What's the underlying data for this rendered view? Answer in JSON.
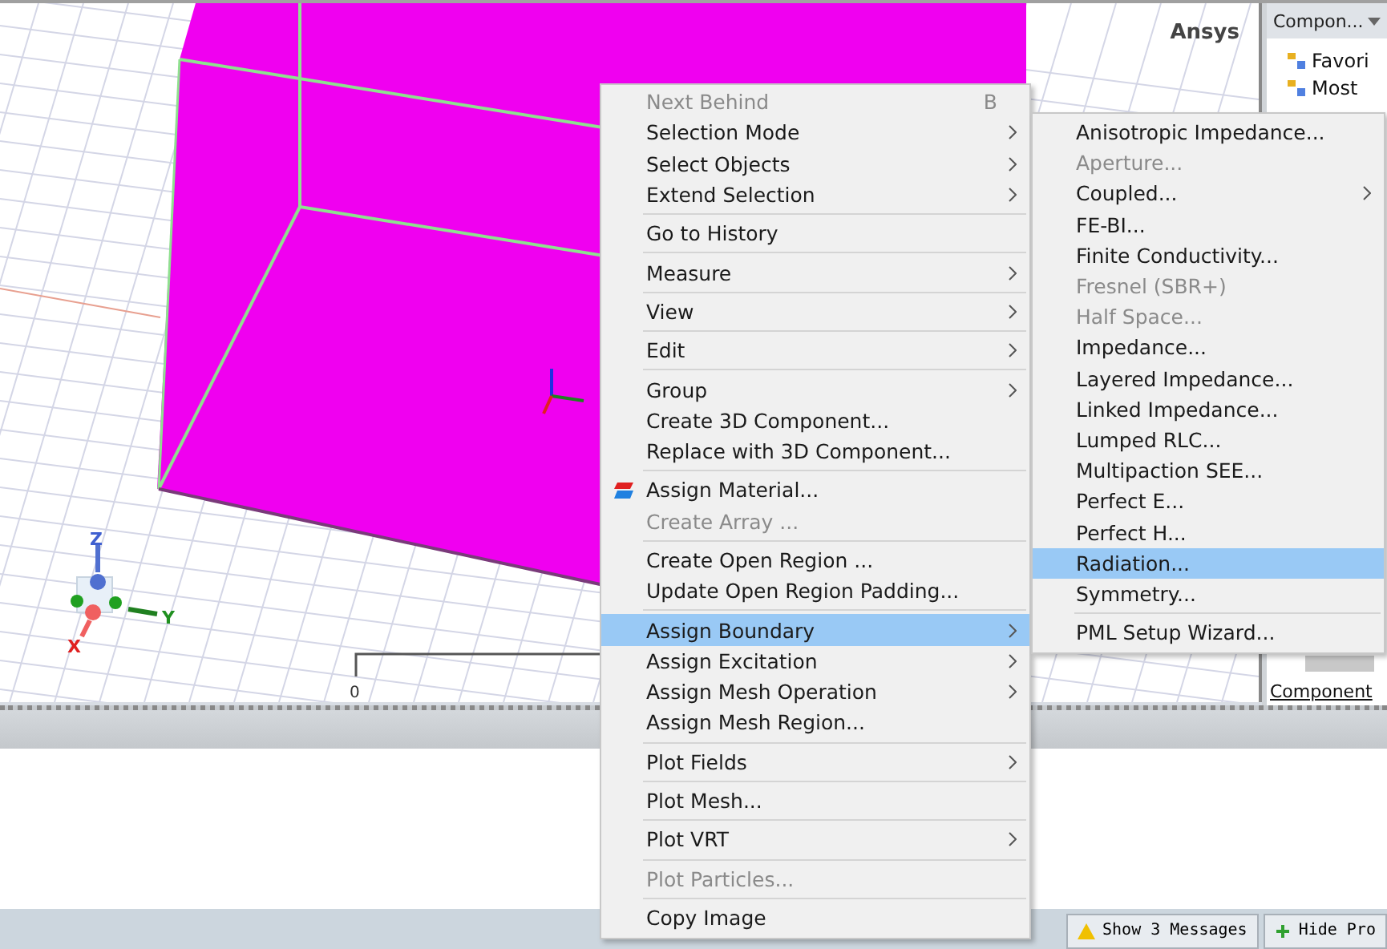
{
  "viewport": {
    "brand": "Ansys",
    "axes": {
      "z": "Z",
      "y": "Y",
      "x": "X"
    },
    "scale_label": "0"
  },
  "side_panel": {
    "title": "Compon...",
    "tree": [
      {
        "label": "Favori"
      },
      {
        "label": "Most"
      }
    ],
    "tab": "Component"
  },
  "context_menu": [
    {
      "kind": "item",
      "label": "Next Behind",
      "shortcut": "B",
      "submenu": false,
      "disabled": true,
      "selected": false,
      "icon": false
    },
    {
      "kind": "item",
      "label": "Selection Mode",
      "submenu": true,
      "disabled": false,
      "selected": false,
      "icon": false
    },
    {
      "kind": "item",
      "label": "Select Objects",
      "submenu": true,
      "disabled": false,
      "selected": false,
      "icon": false
    },
    {
      "kind": "item",
      "label": "Extend Selection",
      "submenu": true,
      "disabled": false,
      "selected": false,
      "icon": false
    },
    {
      "kind": "separator"
    },
    {
      "kind": "item",
      "label": "Go to History",
      "submenu": false,
      "disabled": false,
      "selected": false,
      "icon": false
    },
    {
      "kind": "separator"
    },
    {
      "kind": "item",
      "label": "Measure",
      "submenu": true,
      "disabled": false,
      "selected": false,
      "icon": false
    },
    {
      "kind": "separator"
    },
    {
      "kind": "item",
      "label": "View",
      "submenu": true,
      "disabled": false,
      "selected": false,
      "icon": false
    },
    {
      "kind": "separator"
    },
    {
      "kind": "item",
      "label": "Edit",
      "submenu": true,
      "disabled": false,
      "selected": false,
      "icon": false
    },
    {
      "kind": "separator"
    },
    {
      "kind": "item",
      "label": "Group",
      "submenu": true,
      "disabled": false,
      "selected": false,
      "icon": false
    },
    {
      "kind": "item",
      "label": "Create 3D Component...",
      "submenu": false,
      "disabled": false,
      "selected": false,
      "icon": false
    },
    {
      "kind": "item",
      "label": "Replace with 3D Component...",
      "submenu": false,
      "disabled": false,
      "selected": false,
      "icon": false
    },
    {
      "kind": "separator"
    },
    {
      "kind": "item",
      "label": "Assign Material...",
      "submenu": false,
      "disabled": false,
      "selected": false,
      "icon": true
    },
    {
      "kind": "item",
      "label": "Create Array ...",
      "submenu": false,
      "disabled": true,
      "selected": false,
      "icon": false
    },
    {
      "kind": "separator"
    },
    {
      "kind": "item",
      "label": "Create Open Region ...",
      "submenu": false,
      "disabled": false,
      "selected": false,
      "icon": false
    },
    {
      "kind": "item",
      "label": "Update Open Region Padding...",
      "submenu": false,
      "disabled": false,
      "selected": false,
      "icon": false
    },
    {
      "kind": "separator"
    },
    {
      "kind": "item",
      "label": "Assign Boundary",
      "submenu": true,
      "disabled": false,
      "selected": true,
      "icon": false
    },
    {
      "kind": "item",
      "label": "Assign Excitation",
      "submenu": true,
      "disabled": false,
      "selected": false,
      "icon": false
    },
    {
      "kind": "item",
      "label": "Assign Mesh Operation",
      "submenu": true,
      "disabled": false,
      "selected": false,
      "icon": false
    },
    {
      "kind": "item",
      "label": "Assign Mesh Region...",
      "submenu": false,
      "disabled": false,
      "selected": false,
      "icon": false
    },
    {
      "kind": "separator"
    },
    {
      "kind": "item",
      "label": "Plot Fields",
      "submenu": true,
      "disabled": false,
      "selected": false,
      "icon": false
    },
    {
      "kind": "separator"
    },
    {
      "kind": "item",
      "label": "Plot Mesh...",
      "submenu": false,
      "disabled": false,
      "selected": false,
      "icon": false
    },
    {
      "kind": "separator"
    },
    {
      "kind": "item",
      "label": "Plot VRT",
      "submenu": true,
      "disabled": false,
      "selected": false,
      "icon": false
    },
    {
      "kind": "separator"
    },
    {
      "kind": "item",
      "label": "Plot Particles...",
      "submenu": false,
      "disabled": true,
      "selected": false,
      "icon": false
    },
    {
      "kind": "separator"
    },
    {
      "kind": "item",
      "label": "Copy Image",
      "submenu": false,
      "disabled": false,
      "selected": false,
      "icon": false
    }
  ],
  "submenu": [
    {
      "kind": "item",
      "label": "Anisotropic Impedance...",
      "submenu": false,
      "disabled": false,
      "selected": false
    },
    {
      "kind": "item",
      "label": "Aperture...",
      "submenu": false,
      "disabled": true,
      "selected": false
    },
    {
      "kind": "item",
      "label": "Coupled...",
      "submenu": true,
      "disabled": false,
      "selected": false
    },
    {
      "kind": "item",
      "label": "FE-BI...",
      "submenu": false,
      "disabled": false,
      "selected": false
    },
    {
      "kind": "item",
      "label": "Finite Conductivity...",
      "submenu": false,
      "disabled": false,
      "selected": false
    },
    {
      "kind": "item",
      "label": "Fresnel (SBR+)",
      "submenu": false,
      "disabled": true,
      "selected": false
    },
    {
      "kind": "item",
      "label": "Half Space...",
      "submenu": false,
      "disabled": true,
      "selected": false
    },
    {
      "kind": "item",
      "label": "Impedance...",
      "submenu": false,
      "disabled": false,
      "selected": false
    },
    {
      "kind": "item",
      "label": "Layered Impedance...",
      "submenu": false,
      "disabled": false,
      "selected": false
    },
    {
      "kind": "item",
      "label": "Linked Impedance...",
      "submenu": false,
      "disabled": false,
      "selected": false
    },
    {
      "kind": "item",
      "label": "Lumped RLC...",
      "submenu": false,
      "disabled": false,
      "selected": false
    },
    {
      "kind": "item",
      "label": "Multipaction SEE...",
      "submenu": false,
      "disabled": false,
      "selected": false
    },
    {
      "kind": "item",
      "label": "Perfect E...",
      "submenu": false,
      "disabled": false,
      "selected": false
    },
    {
      "kind": "item",
      "label": "Perfect H...",
      "submenu": false,
      "disabled": false,
      "selected": false
    },
    {
      "kind": "item",
      "label": "Radiation...",
      "submenu": false,
      "disabled": false,
      "selected": true
    },
    {
      "kind": "item",
      "label": "Symmetry...",
      "submenu": false,
      "disabled": false,
      "selected": false
    },
    {
      "kind": "separator"
    },
    {
      "kind": "item",
      "label": "PML Setup Wizard...",
      "submenu": false,
      "disabled": false,
      "selected": false
    }
  ],
  "status_bar": {
    "buttons": [
      {
        "label": "Show 3 Messages"
      },
      {
        "label": "Hide Pro"
      }
    ]
  }
}
